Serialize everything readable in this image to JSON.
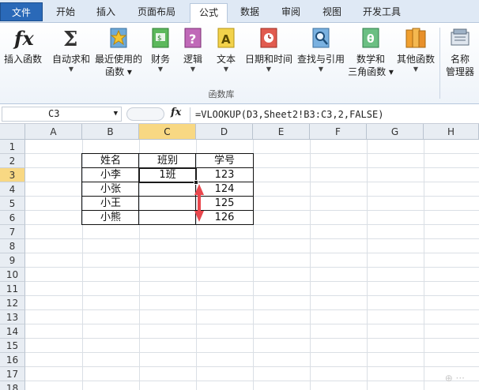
{
  "ribbon_tabs": [
    "文件",
    "开始",
    "插入",
    "页面布局",
    "公式",
    "数据",
    "审阅",
    "视图",
    "开发工具"
  ],
  "ribbon_buttons": {
    "insert_function": "插入函数",
    "autosum": "自动求和",
    "recent_line1": "最近使用的",
    "recent_line2": "函数",
    "financial": "财务",
    "logical": "逻辑",
    "text": "文本",
    "datetime": "日期和时间",
    "lookup": "查找与引用",
    "math_line1": "数学和",
    "math_line2": "三角函数",
    "more": "其他函数",
    "name_mgr_line1": "名称",
    "name_mgr_line2": "管理器"
  },
  "ribbon_group_label": "函数库",
  "formula_bar": {
    "name_box": "C3",
    "fx_label": "fx",
    "formula": "=VLOOKUP(D3,Sheet2!B3:C3,2,FALSE)"
  },
  "columns": [
    "A",
    "B",
    "C",
    "D",
    "E",
    "F",
    "G",
    "H"
  ],
  "rows": [
    "1",
    "2",
    "3",
    "4",
    "5",
    "6",
    "7",
    "8",
    "9",
    "10",
    "11",
    "12",
    "13",
    "14",
    "15",
    "16",
    "17",
    "18"
  ],
  "table": {
    "headers": [
      "姓名",
      "班别",
      "学号"
    ],
    "rows": [
      [
        "小李",
        "1班",
        "123"
      ],
      [
        "小张",
        "",
        "124"
      ],
      [
        "小王",
        "",
        "125"
      ],
      [
        "小熊",
        "",
        "126"
      ]
    ]
  },
  "colors": {
    "selected_header": "#f8d883",
    "arrow": "#e8474d",
    "file_tab": "#2a69b8"
  }
}
